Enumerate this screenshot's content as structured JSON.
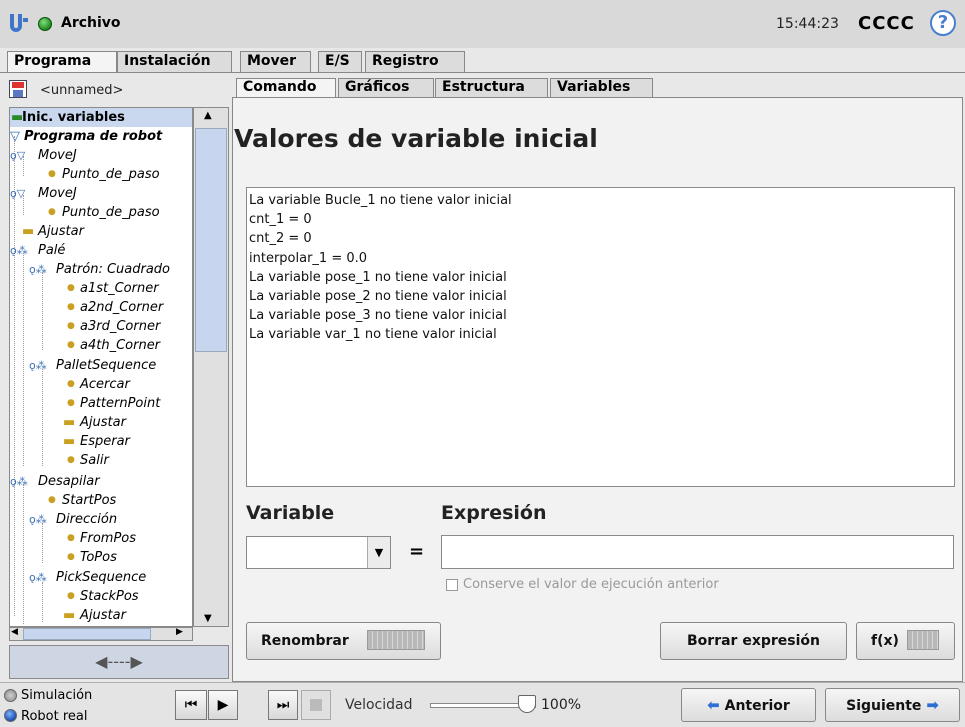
{
  "header": {
    "menu_label": "Archivo",
    "time": "15:44:23",
    "robot_name": "CCCC",
    "help_label": "?"
  },
  "main_tabs": [
    "Programa",
    "Instalación",
    "Mover",
    "E/S",
    "Registro"
  ],
  "program": {
    "filename": "<unnamed>"
  },
  "tree": [
    {
      "label": "Inic. variables",
      "icon": "assignment-icon"
    },
    {
      "label": "Programa de robot",
      "icon": "collapse-triangle-icon"
    },
    {
      "label": "MoveJ",
      "icon": "collapse-triangle-icon"
    },
    {
      "label": "Punto_de_paso",
      "icon": "waypoint-icon"
    },
    {
      "label": "MoveJ",
      "icon": "collapse-triangle-icon"
    },
    {
      "label": "Punto_de_paso",
      "icon": "waypoint-icon"
    },
    {
      "label": "Ajustar",
      "icon": "set-icon"
    },
    {
      "label": "Palé",
      "icon": "pallet-icon"
    },
    {
      "label": "Patrón: Cuadrado",
      "icon": "pallet-icon"
    },
    {
      "label": "a1st_Corner",
      "icon": "waypoint-icon"
    },
    {
      "label": "a2nd_Corner",
      "icon": "waypoint-icon"
    },
    {
      "label": "a3rd_Corner",
      "icon": "waypoint-icon"
    },
    {
      "label": "a4th_Corner",
      "icon": "waypoint-icon"
    },
    {
      "label": "PalletSequence",
      "icon": "pallet-icon"
    },
    {
      "label": "Acercar",
      "icon": "waypoint-icon"
    },
    {
      "label": "PatternPoint",
      "icon": "waypoint-icon"
    },
    {
      "label": "Ajustar",
      "icon": "set-icon"
    },
    {
      "label": "Esperar",
      "icon": "set-icon"
    },
    {
      "label": "Salir",
      "icon": "waypoint-icon"
    },
    {
      "label": "Desapilar",
      "icon": "pallet-icon"
    },
    {
      "label": "StartPos",
      "icon": "waypoint-icon"
    },
    {
      "label": "Dirección",
      "icon": "pallet-icon"
    },
    {
      "label": "FromPos",
      "icon": "waypoint-icon"
    },
    {
      "label": "ToPos",
      "icon": "waypoint-icon"
    },
    {
      "label": "PickSequence",
      "icon": "pallet-icon"
    },
    {
      "label": "StackPos",
      "icon": "waypoint-icon"
    },
    {
      "label": "Ajustar",
      "icon": "set-icon"
    }
  ],
  "nav_arrows": "◀----▶",
  "sub_tabs": [
    "Comando",
    "Gráficos",
    "Estructura",
    "Variables"
  ],
  "content": {
    "title": "Valores de variable inicial",
    "variables": [
      "La variable Bucle_1 no tiene valor inicial",
      "cnt_1 = 0",
      "cnt_2 = 0",
      "interpolar_1 = 0.0",
      "La variable pose_1 no tiene valor inicial",
      "La variable pose_2 no tiene valor inicial",
      "La variable pose_3 no tiene valor inicial",
      "La variable var_1 no tiene valor inicial"
    ],
    "variable_label": "Variable",
    "expression_label": "Expresión",
    "equals": "=",
    "expression_value": "",
    "keep_previous_label": "Conserve el valor de ejecución anterior",
    "rename_button": "Renombrar",
    "clear_button": "Borrar expresión",
    "fx_button": "f(x)"
  },
  "footer": {
    "simulation_label": "Simulación",
    "real_robot_label": "Robot real",
    "speed_label": "Velocidad",
    "speed_value": "100%",
    "speed_fraction": 1.0,
    "prev_button": "Anterior",
    "next_button": "Siguiente"
  },
  "colors": {
    "selection": "#c9d7ef",
    "accent": "#2e6fd6",
    "status_ok": "#1f8a1f"
  }
}
